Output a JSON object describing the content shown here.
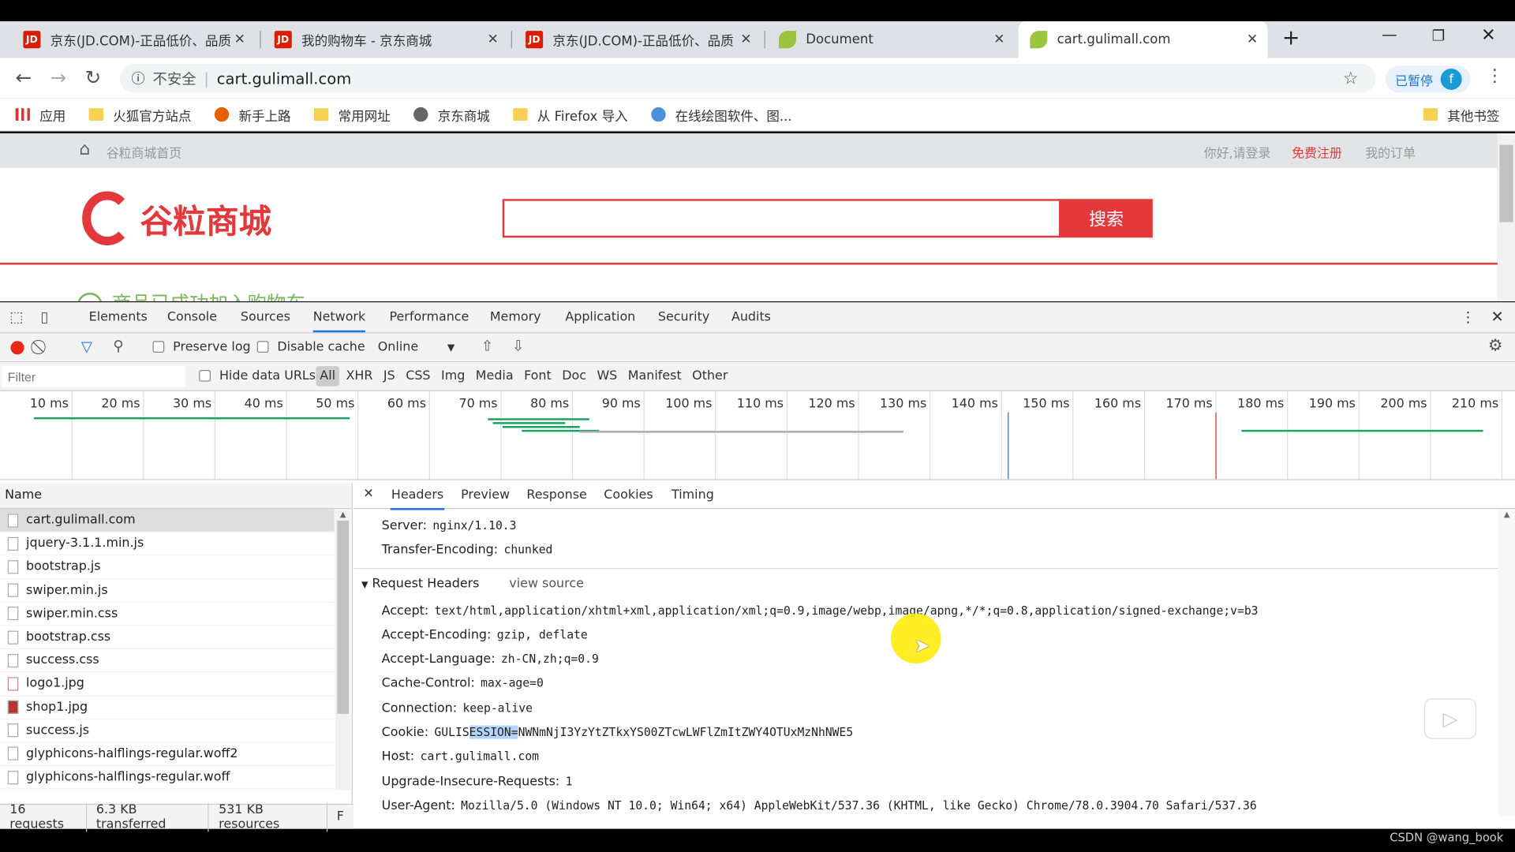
{
  "browser": {
    "tabs": [
      {
        "title": "京东(JD.COM)-正品低价、品质",
        "icon": "jd-icon"
      },
      {
        "title": "我的购物车 - 京东商城",
        "icon": "jd-icon"
      },
      {
        "title": "京东(JD.COM)-正品低价、品质",
        "icon": "jd-icon"
      },
      {
        "title": "Document",
        "icon": "leaf-icon"
      },
      {
        "title": "cart.gulimall.com",
        "icon": "leaf-icon",
        "active": true
      }
    ],
    "fav_label": "JD",
    "new_tab": "+",
    "security_label": "不安全",
    "url": "cart.gulimall.com",
    "profile_label": "已暂停",
    "profile_initial": "f",
    "bookmarks": [
      "应用",
      "火狐官方站点",
      "新手上路",
      "常用网址",
      "京东商城",
      "从 Firefox 导入",
      "在线绘图软件、图..."
    ],
    "other_bookmarks": "其他书签"
  },
  "page": {
    "home_link": "谷粒商城首页",
    "login": "你好,请登录",
    "register": "免费注册",
    "orders": "我的订单",
    "logo_text": "谷粒商城",
    "search_button": "搜索",
    "success_msg": "商品已成功加入购物车"
  },
  "devtools": {
    "tabs": [
      "Elements",
      "Console",
      "Sources",
      "Network",
      "Performance",
      "Memory",
      "Application",
      "Security",
      "Audits"
    ],
    "active_tab": "Network",
    "preserve_log": "Preserve log",
    "disable_cache": "Disable cache",
    "throttle": "Online",
    "filter_placeholder": "Filter",
    "hide_data_urls": "Hide data URLs",
    "types": [
      "All",
      "XHR",
      "JS",
      "CSS",
      "Img",
      "Media",
      "Font",
      "Doc",
      "WS",
      "Manifest",
      "Other"
    ],
    "timeline_ticks": [
      "10 ms",
      "20 ms",
      "30 ms",
      "40 ms",
      "50 ms",
      "60 ms",
      "70 ms",
      "80 ms",
      "90 ms",
      "100 ms",
      "110 ms",
      "120 ms",
      "130 ms",
      "140 ms",
      "150 ms",
      "160 ms",
      "170 ms",
      "180 ms",
      "190 ms",
      "200 ms",
      "210 ms"
    ],
    "name_header": "Name",
    "requests": [
      "cart.gulimall.com",
      "jquery-3.1.1.min.js",
      "bootstrap.js",
      "swiper.min.js",
      "swiper.min.css",
      "bootstrap.css",
      "success.css",
      "logo1.jpg",
      "shop1.jpg",
      "success.js",
      "glyphicons-halflings-regular.woff2",
      "glyphicons-halflings-regular.woff"
    ],
    "detail_tabs": [
      "Headers",
      "Preview",
      "Response",
      "Cookies",
      "Timing"
    ],
    "response_headers": [
      {
        "k": "Server:",
        "v": "nginx/1.10.3"
      },
      {
        "k": "Transfer-Encoding:",
        "v": "chunked"
      }
    ],
    "request_headers_title": "Request Headers",
    "view_source": "view source",
    "request_headers": [
      {
        "k": "Accept:",
        "v": "text/html,application/xhtml+xml,application/xml;q=0.9,image/webp,image/apng,*/*;q=0.8,application/signed-exchange;v=b3"
      },
      {
        "k": "Accept-Encoding:",
        "v": "gzip, deflate"
      },
      {
        "k": "Accept-Language:",
        "v": "zh-CN,zh;q=0.9"
      },
      {
        "k": "Cache-Control:",
        "v": "max-age=0"
      },
      {
        "k": "Connection:",
        "v": "keep-alive"
      },
      {
        "k": "Cookie:",
        "v_pre": "GULIS",
        "v_sel": "ESSION=",
        "v_post": "NWNmNjI3YzYtZTkxYS00ZTcwLWFlZmItZWY4OTUxMzNhNWE5"
      },
      {
        "k": "Host:",
        "v": "cart.gulimall.com"
      },
      {
        "k": "Upgrade-Insecure-Requests:",
        "v": "1"
      },
      {
        "k": "User-Agent:",
        "v": "Mozilla/5.0 (Windows NT 10.0; Win64; x64) AppleWebKit/537.36 (KHTML, like Gecko) Chrome/78.0.3904.70 Safari/537.36"
      }
    ],
    "status": [
      "16 requests",
      "6.3 KB transferred",
      "531 KB resources",
      "F"
    ]
  },
  "watermark": "CSDN @wang_book"
}
